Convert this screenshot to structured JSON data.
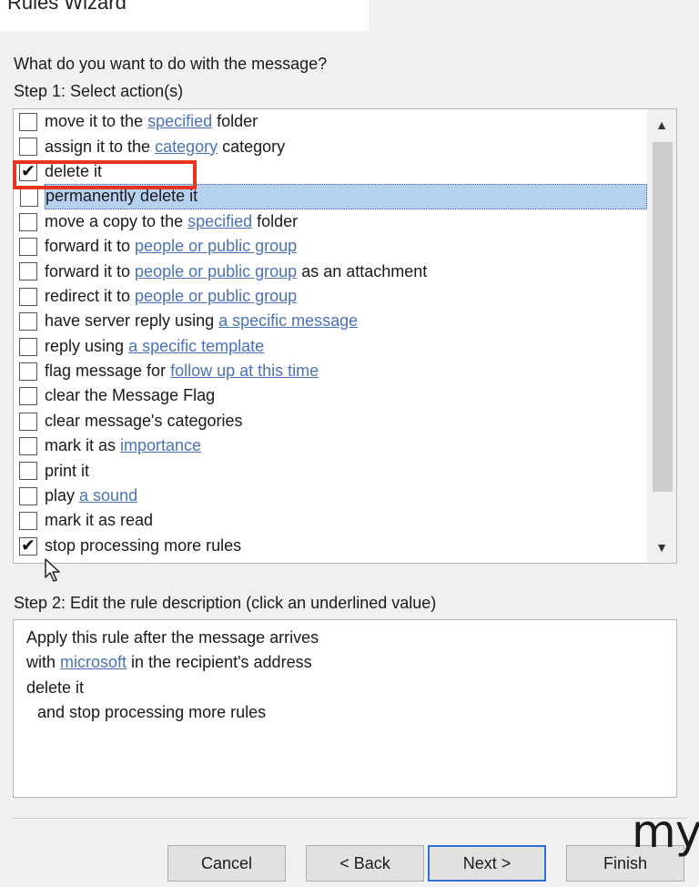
{
  "window": {
    "title": "Rules Wizard"
  },
  "question": "What do you want to do with the message?",
  "step1_label": "Step 1: Select action(s)",
  "actions": [
    {
      "checked": false,
      "selected": false,
      "segments": [
        {
          "text": "move it to the ",
          "link": false
        },
        {
          "text": "specified",
          "link": true
        },
        {
          "text": " folder",
          "link": false
        }
      ]
    },
    {
      "checked": false,
      "selected": false,
      "segments": [
        {
          "text": "assign it to the ",
          "link": false
        },
        {
          "text": "category",
          "link": true
        },
        {
          "text": " category",
          "link": false
        }
      ]
    },
    {
      "checked": true,
      "selected": false,
      "segments": [
        {
          "text": "delete it",
          "link": false
        }
      ]
    },
    {
      "checked": false,
      "selected": true,
      "segments": [
        {
          "text": "permanently delete it",
          "link": false
        }
      ]
    },
    {
      "checked": false,
      "selected": false,
      "segments": [
        {
          "text": "move a copy to the ",
          "link": false
        },
        {
          "text": "specified",
          "link": true
        },
        {
          "text": " folder",
          "link": false
        }
      ]
    },
    {
      "checked": false,
      "selected": false,
      "segments": [
        {
          "text": "forward it to ",
          "link": false
        },
        {
          "text": "people or public group",
          "link": true
        }
      ]
    },
    {
      "checked": false,
      "selected": false,
      "segments": [
        {
          "text": "forward it to ",
          "link": false
        },
        {
          "text": "people or public group",
          "link": true
        },
        {
          "text": " as an attachment",
          "link": false
        }
      ]
    },
    {
      "checked": false,
      "selected": false,
      "segments": [
        {
          "text": "redirect it to ",
          "link": false
        },
        {
          "text": "people or public group",
          "link": true
        }
      ]
    },
    {
      "checked": false,
      "selected": false,
      "segments": [
        {
          "text": "have server reply using ",
          "link": false
        },
        {
          "text": "a specific message",
          "link": true
        }
      ]
    },
    {
      "checked": false,
      "selected": false,
      "segments": [
        {
          "text": "reply using ",
          "link": false
        },
        {
          "text": "a specific template",
          "link": true
        }
      ]
    },
    {
      "checked": false,
      "selected": false,
      "segments": [
        {
          "text": "flag message for ",
          "link": false
        },
        {
          "text": "follow up at this time",
          "link": true
        }
      ]
    },
    {
      "checked": false,
      "selected": false,
      "segments": [
        {
          "text": "clear the Message Flag",
          "link": false
        }
      ]
    },
    {
      "checked": false,
      "selected": false,
      "segments": [
        {
          "text": "clear message's categories",
          "link": false
        }
      ]
    },
    {
      "checked": false,
      "selected": false,
      "segments": [
        {
          "text": "mark it as ",
          "link": false
        },
        {
          "text": "importance",
          "link": true
        }
      ]
    },
    {
      "checked": false,
      "selected": false,
      "segments": [
        {
          "text": "print it",
          "link": false
        }
      ]
    },
    {
      "checked": false,
      "selected": false,
      "segments": [
        {
          "text": "play ",
          "link": false
        },
        {
          "text": "a sound",
          "link": true
        }
      ]
    },
    {
      "checked": false,
      "selected": false,
      "segments": [
        {
          "text": "mark it as read",
          "link": false
        }
      ]
    },
    {
      "checked": true,
      "selected": false,
      "segments": [
        {
          "text": "stop processing more rules",
          "link": false
        }
      ]
    }
  ],
  "step2_label": "Step 2: Edit the rule description (click an underlined value)",
  "description": {
    "line1": "Apply this rule after the message arrives",
    "line2_prefix": "with ",
    "line2_link": "microsoft",
    "line2_suffix": " in the recipient's address",
    "line3": "delete it",
    "line4": "and stop processing more rules"
  },
  "buttons": {
    "cancel": "Cancel",
    "back": "< Back",
    "next": "Next >",
    "finish": "Finish"
  },
  "watermark": "my",
  "colors": {
    "link": "#4a72b8",
    "selection": "#b6d0ef",
    "highlight_box": "#e8341c",
    "primary_button_border": "#2f6fd0"
  }
}
